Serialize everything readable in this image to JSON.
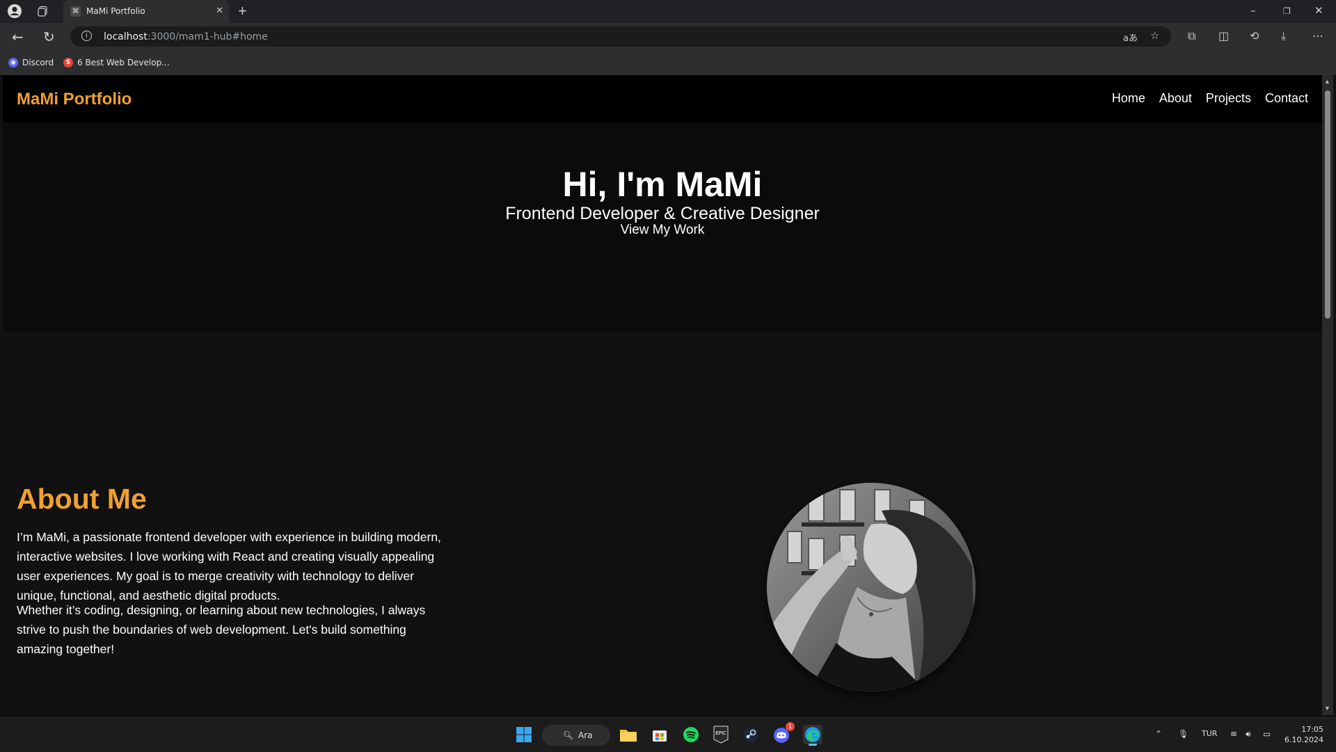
{
  "browser": {
    "tab_title": "MaMi Portfolio",
    "url_host": "localhost",
    "url_rest": ":3000/mam1-hub#home",
    "bookmarks": [
      {
        "label": "Discord"
      },
      {
        "label": "6 Best Web Develop..."
      }
    ]
  },
  "site": {
    "brand": "MaMi Portfolio",
    "nav": [
      "Home",
      "About",
      "Projects",
      "Contact"
    ],
    "hero": {
      "title": "Hi, I'm MaMi",
      "subtitle": "Frontend Developer & Creative Designer",
      "cta": "View My Work"
    },
    "about": {
      "heading": "About Me",
      "paragraph1": "I’m MaMi, a passionate frontend developer with experience in building modern, interactive websites. I love working with React and creating visually appealing user experiences. My goal is to merge creativity with technology to deliver unique, functional, and aesthetic digital products.",
      "paragraph2": "Whether it’s coding, designing, or learning about new technologies, I always strive to push the boundaries of web development. Let's build something amazing together!"
    },
    "colors": {
      "accent": "#f0a030",
      "nav_bg": "#000000",
      "page_bg": "#111111"
    }
  },
  "taskbar": {
    "search_label": "Ara",
    "language": "TUR",
    "time": "17:05",
    "date": "6.10.2024",
    "discord_badge": "1"
  }
}
